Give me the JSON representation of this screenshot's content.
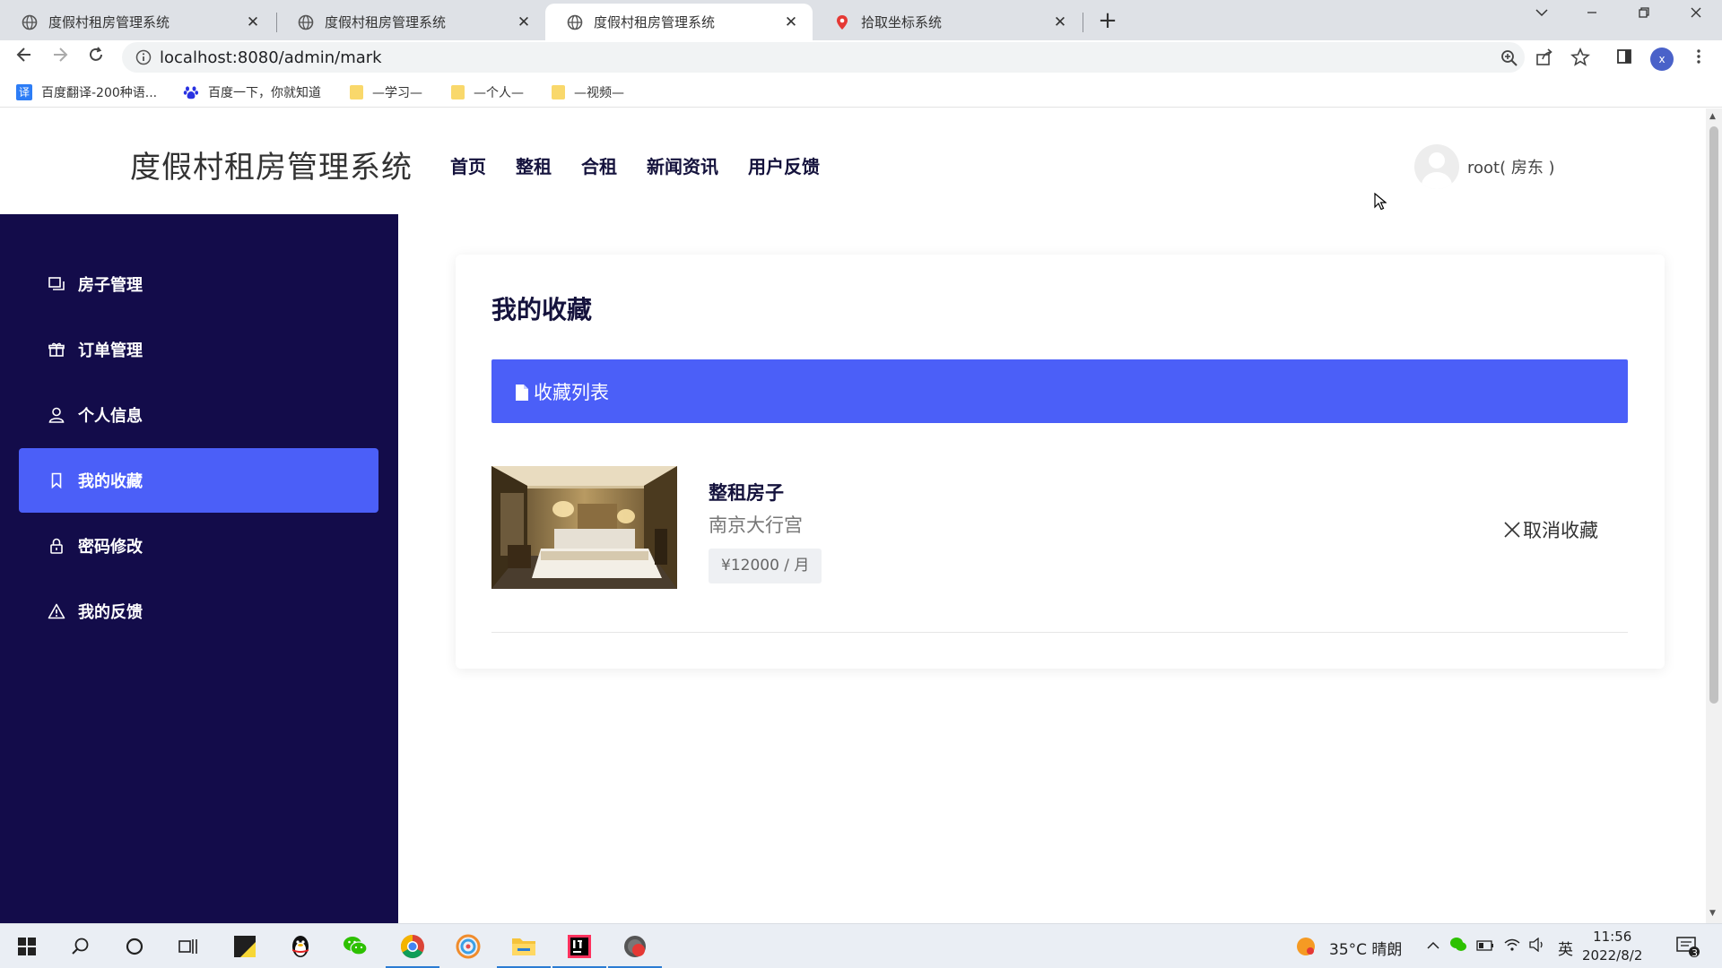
{
  "browser": {
    "tabs": [
      {
        "title": "度假村租房管理系统",
        "active": false
      },
      {
        "title": "度假村租房管理系统",
        "active": false
      },
      {
        "title": "度假村租房管理系统",
        "active": true
      },
      {
        "title": "拾取坐标系统",
        "active": false
      }
    ],
    "url": "localhost:8080/admin/mark",
    "bookmarks": [
      {
        "label": "百度翻译-200种语...",
        "icon": "translate-icon"
      },
      {
        "label": "百度一下，你就知道",
        "icon": "baidu-paw-icon"
      },
      {
        "label": "—学习—",
        "icon": "folder-icon"
      },
      {
        "label": "—个人—",
        "icon": "folder-icon"
      },
      {
        "label": "—视频—",
        "icon": "folder-icon"
      }
    ],
    "profile_initial": "x",
    "new_tab_label": "+",
    "close_label": "✕"
  },
  "site": {
    "logo": "度假村租房管理系统",
    "nav": [
      "首页",
      "整租",
      "合租",
      "新闻资讯",
      "用户反馈"
    ],
    "user": "root( 房东 )"
  },
  "sidebar": {
    "items": [
      {
        "label": "房子管理",
        "icon": "house-manage-icon",
        "active": false
      },
      {
        "label": "订单管理",
        "icon": "gift-icon",
        "active": false
      },
      {
        "label": "个人信息",
        "icon": "user-icon",
        "active": false
      },
      {
        "label": "我的收藏",
        "icon": "bookmark-icon",
        "active": true
      },
      {
        "label": "密码修改",
        "icon": "lock-icon",
        "active": false
      },
      {
        "label": "我的反馈",
        "icon": "warning-icon",
        "active": false
      }
    ]
  },
  "main": {
    "title": "我的收藏",
    "list_header": "收藏列表",
    "favorites": [
      {
        "type": "整租房子",
        "location": "南京大行宫",
        "price": "¥12000 / 月",
        "action": "取消收藏"
      }
    ]
  },
  "taskbar": {
    "weather": "35°C 晴朗",
    "ime": "英",
    "time": "11:56",
    "date": "2022/8/2",
    "notifications": "3"
  },
  "colors": {
    "sidebar_bg": "#130c4a",
    "accent": "#4b5ff8",
    "nav_text": "#15133d"
  }
}
